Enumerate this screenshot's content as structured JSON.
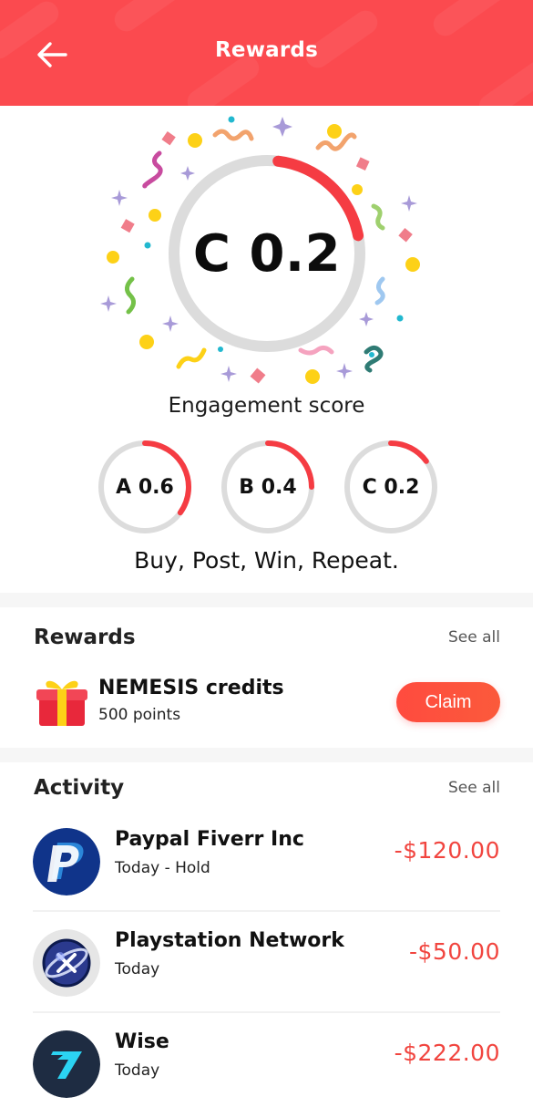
{
  "header": {
    "title": "Rewards",
    "back_icon": "arrow-left-icon",
    "color": "#fb4a4f"
  },
  "score": {
    "main_label": "C 0.2",
    "main_value": 0.2,
    "caption": "Engagement score",
    "grades": [
      {
        "label": "A 0.6",
        "value": 0.6
      },
      {
        "label": "B 0.4",
        "value": 0.4
      },
      {
        "label": "C 0.2",
        "value": 0.2
      }
    ],
    "tagline": "Buy, Post, Win, Repeat.",
    "accent_color": "#f53c43",
    "track_color": "#dcdcdc"
  },
  "rewards": {
    "title": "Rewards",
    "see_all": "See all",
    "item": {
      "icon": "gift-icon",
      "name": "NEMESIS credits",
      "points": "500 points",
      "claim_label": "Claim"
    }
  },
  "activity": {
    "title": "Activity",
    "see_all": "See all",
    "items": [
      {
        "icon": "paypal-logo-icon",
        "name": "Paypal Fiverr Inc",
        "sub": "Today - Hold",
        "amount": "-$120.00"
      },
      {
        "icon": "playstation-network-logo-icon",
        "name": "Playstation Network",
        "sub": "Today",
        "amount": "-$50.00"
      },
      {
        "icon": "wise-logo-icon",
        "name": "Wise",
        "sub": "Today",
        "amount": "-$222.00"
      }
    ],
    "amount_color": "#f1453f"
  }
}
